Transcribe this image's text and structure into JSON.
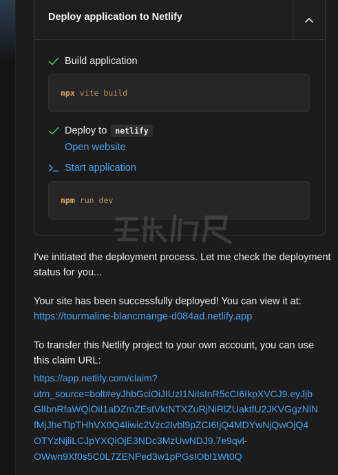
{
  "card": {
    "title": "Deploy application to Netlify",
    "steps": {
      "build": {
        "label": "Build application",
        "command": "npx",
        "args": "vite build"
      },
      "deploy": {
        "label": "Deploy to",
        "target": "netlify",
        "link": "Open website"
      },
      "start": {
        "label": "Start application",
        "command": "npm",
        "args": "run dev"
      }
    }
  },
  "messages": {
    "m1": "I've initiated the deployment process. Let me check the deployment status for you...",
    "m2_text": "Your site has been successfully deployed! You can view it at:",
    "m2_link": "https://tourmaline-blancmange-d084ad.netlify.app",
    "m3_text": "To transfer this Netlify project to your own account, you can use  this claim URL:",
    "claim_url_lines": [
      "https://app.netlify.com/claim?",
      "utm_source=bolt#eyJhbGciOiJIUzI1NiIsInR5cCI6IkpXVCJ9.eyJjb",
      "GlIbnRfaWQiOiI1aDZmZEstVktNTXZuRjNiRlZUaktfU2JKVGgzNlN",
      "fMjJheTlpTHhVX0Q4Iiwic2Vzc2lvbl9pZCI6IjQ4MDYwNjQwOjQ4",
      "OTYzNjliLCJpYXQiOjE3NDc3MzUwNDJ9.7e9qvl-",
      "OWwn9Xf0s5C0L7ZENPed3w1pPGsIObI1Wt0Q"
    ]
  },
  "colors": {
    "background": "#1c1c1c",
    "card": "#1b1b1b",
    "success": "#4fbf6f",
    "link": "#4aa3f0",
    "code": "#d9a96b"
  },
  "icons": {
    "collapse": "chevron-up-icon",
    "done": "check-icon",
    "terminal": "terminal-icon"
  }
}
